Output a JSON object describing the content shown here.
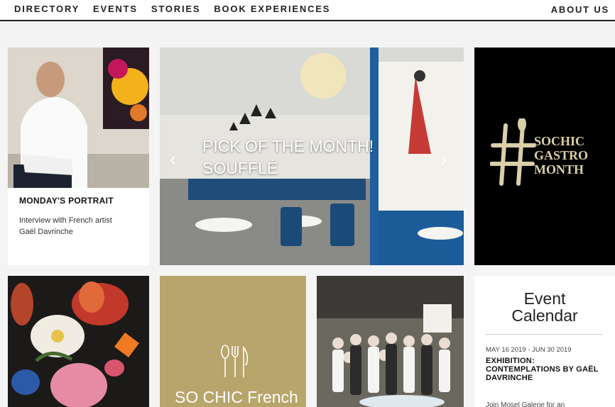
{
  "nav": {
    "items": [
      "DIRECTORY",
      "EVENTS",
      "STORIES",
      "BOOK EXPERIENCES"
    ],
    "about": "ABOUT US"
  },
  "portrait": {
    "heading": "MONDAY'S PORTRAIT",
    "desc_line1": "Interview with French artist",
    "desc_line2": "Gaël Davrinche"
  },
  "slider": {
    "caption_line1": "PICK OF THE MONTH!",
    "caption_line2": "SOUFFLÉ",
    "prev_icon": "chevron-left-icon",
    "next_icon": "chevron-right-icon"
  },
  "gastro": {
    "line1": "SOCHIC",
    "line2": "GASTRO",
    "line3": "MONTH"
  },
  "french": {
    "label": "SO CHIC French"
  },
  "calendar": {
    "title_line1": "Event",
    "title_line2": "Calendar",
    "date": "MAY 16 2019 - JUN 30 2019",
    "event_title": "EXHIBITION: CONTEMPLATIONS BY GAËL DAVRINCHE",
    "desc": "Join Mosel Galerie for an"
  }
}
